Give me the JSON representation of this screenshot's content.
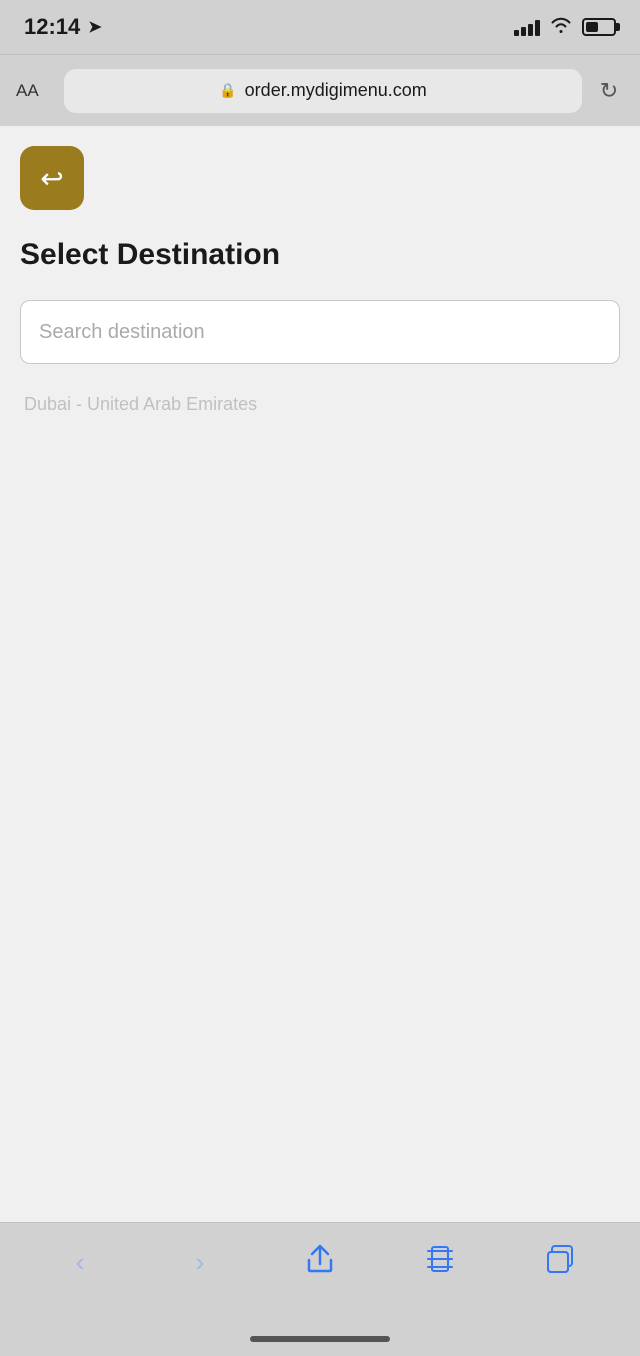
{
  "status_bar": {
    "time": "12:14",
    "arrow": "▶"
  },
  "browser_bar": {
    "aa_label": "AA",
    "url": "order.mydigimenu.com",
    "refresh_symbol": "↻"
  },
  "back_button": {
    "label": "back",
    "arrow": "↩"
  },
  "page": {
    "title": "Select Destination",
    "search_placeholder": "Search destination",
    "destination_hint": "Dubai - United Arab Emirates"
  },
  "bottom_nav": {
    "back": "‹",
    "forward": "›",
    "share": "⬆",
    "bookmarks": "📖",
    "tabs": "⧉"
  },
  "colors": {
    "accent_gold": "#9a7b1e",
    "nav_blue": "#3478f6",
    "nav_blue_disabled": "#9fb8e8"
  }
}
